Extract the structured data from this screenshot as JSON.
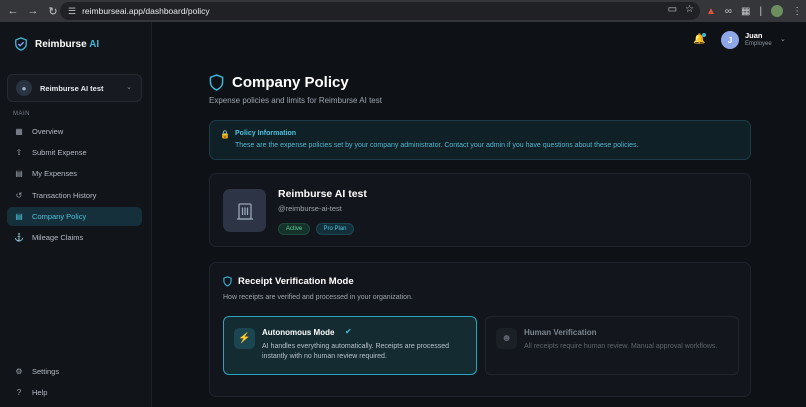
{
  "browser": {
    "url": "reimburseai.app/dashboard/policy"
  },
  "brand": {
    "name_main": "Reimburse",
    "name_accent": "AI"
  },
  "org_selector": {
    "name": "Reimburse AI test"
  },
  "sidebar": {
    "section_label": "MAIN",
    "items": [
      {
        "label": "Overview",
        "icon": "grid-icon",
        "active": false
      },
      {
        "label": "Submit Expense",
        "icon": "upload-icon",
        "active": false
      },
      {
        "label": "My Expenses",
        "icon": "receipt-icon",
        "active": false
      },
      {
        "label": "Transaction History",
        "icon": "history-icon",
        "active": false
      },
      {
        "label": "Company Policy",
        "icon": "document-icon",
        "active": true
      },
      {
        "label": "Mileage Claims",
        "icon": "car-icon",
        "active": false
      }
    ],
    "bottom_items": [
      {
        "label": "Settings",
        "icon": "gear-icon"
      },
      {
        "label": "Help",
        "icon": "help-icon"
      }
    ]
  },
  "header": {
    "user_initial": "J",
    "user_name": "Juan",
    "user_role": "Employee"
  },
  "page": {
    "title": "Company Policy",
    "subtitle": "Expense policies and limits for Reimburse AI test"
  },
  "info": {
    "title": "Policy Information",
    "text": "These are the expense policies set by your company administrator. Contact your admin if you have questions about these policies."
  },
  "org_card": {
    "name": "Reimburse AI test",
    "handle": "@reimburse-ai-test",
    "status_badge": "Active",
    "plan_badge": "Pro Plan"
  },
  "verification": {
    "title": "Receipt Verification Mode",
    "subtitle": "How receipts are verified and processed in your organization.",
    "modes": [
      {
        "title": "Autonomous Mode",
        "description": "AI handles everything automatically. Receipts are processed instantly with no human review required.",
        "selected": true
      },
      {
        "title": "Human Verification",
        "description": "All receipts require human review. Manual approval workflows.",
        "selected": false
      }
    ]
  },
  "colors": {
    "accent": "#3fb6d6",
    "background": "#0e1116",
    "success": "#5fd39a"
  }
}
